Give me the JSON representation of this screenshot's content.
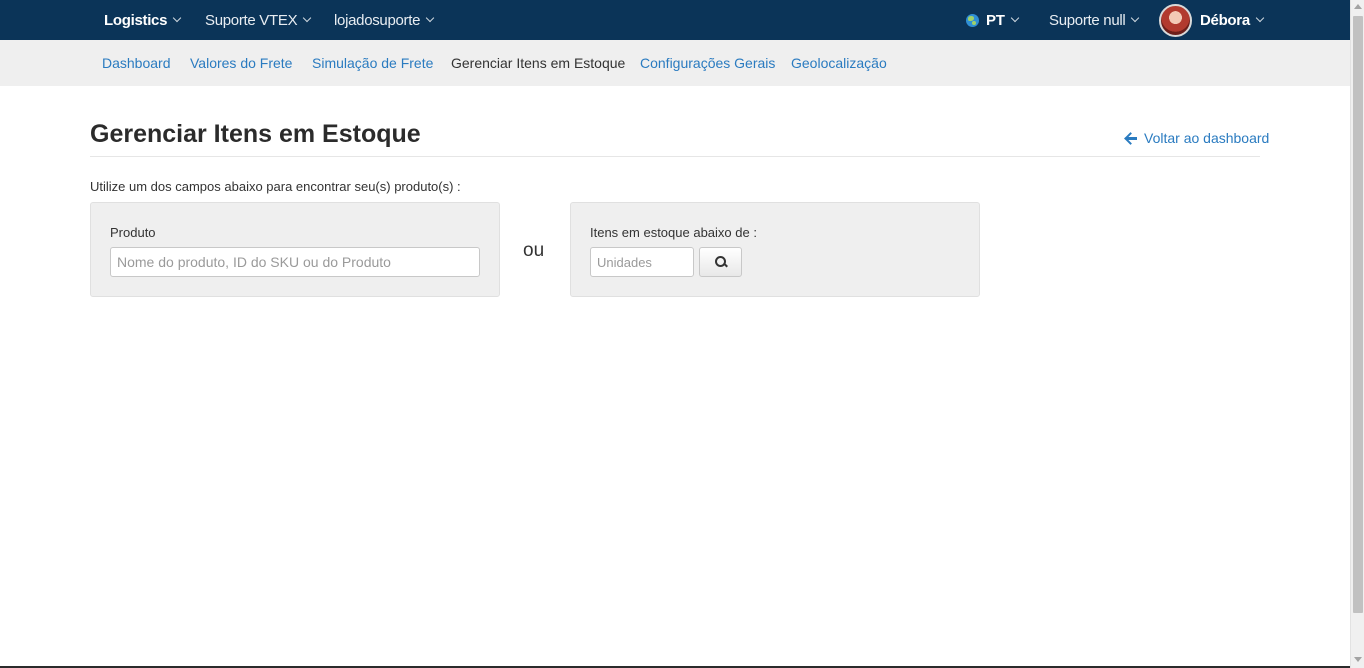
{
  "topbar": {
    "app": "Logistics",
    "menu1": "Suporte VTEX",
    "menu2": "lojadosuporte",
    "language": "PT",
    "account": "Suporte null",
    "user": "Débora"
  },
  "subnav": {
    "items": [
      {
        "label": "Dashboard"
      },
      {
        "label": "Valores do Frete"
      },
      {
        "label": "Simulação de Frete"
      },
      {
        "label": "Gerenciar Itens em Estoque"
      },
      {
        "label": "Configurações Gerais"
      },
      {
        "label": "Geolocalização"
      }
    ],
    "active_index": 3
  },
  "page": {
    "title": "Gerenciar Itens em Estoque",
    "back_link": "Voltar ao dashboard",
    "intro": "Utilize um dos campos abaixo para encontrar seu(s) produto(s) :",
    "product_label": "Produto",
    "product_placeholder": "Nome do produto, ID do SKU ou do Produto",
    "or_text": "ou",
    "stock_label": "Itens em estoque abaixo de :",
    "units_placeholder": "Unidades"
  },
  "icons": {
    "language": "globe-icon",
    "user": "avatar",
    "back": "arrow-left-icon",
    "search": "search-icon"
  },
  "colors": {
    "topbar": "#0b3458",
    "link": "#2a7bc0",
    "subnav_bg": "#efefef"
  }
}
